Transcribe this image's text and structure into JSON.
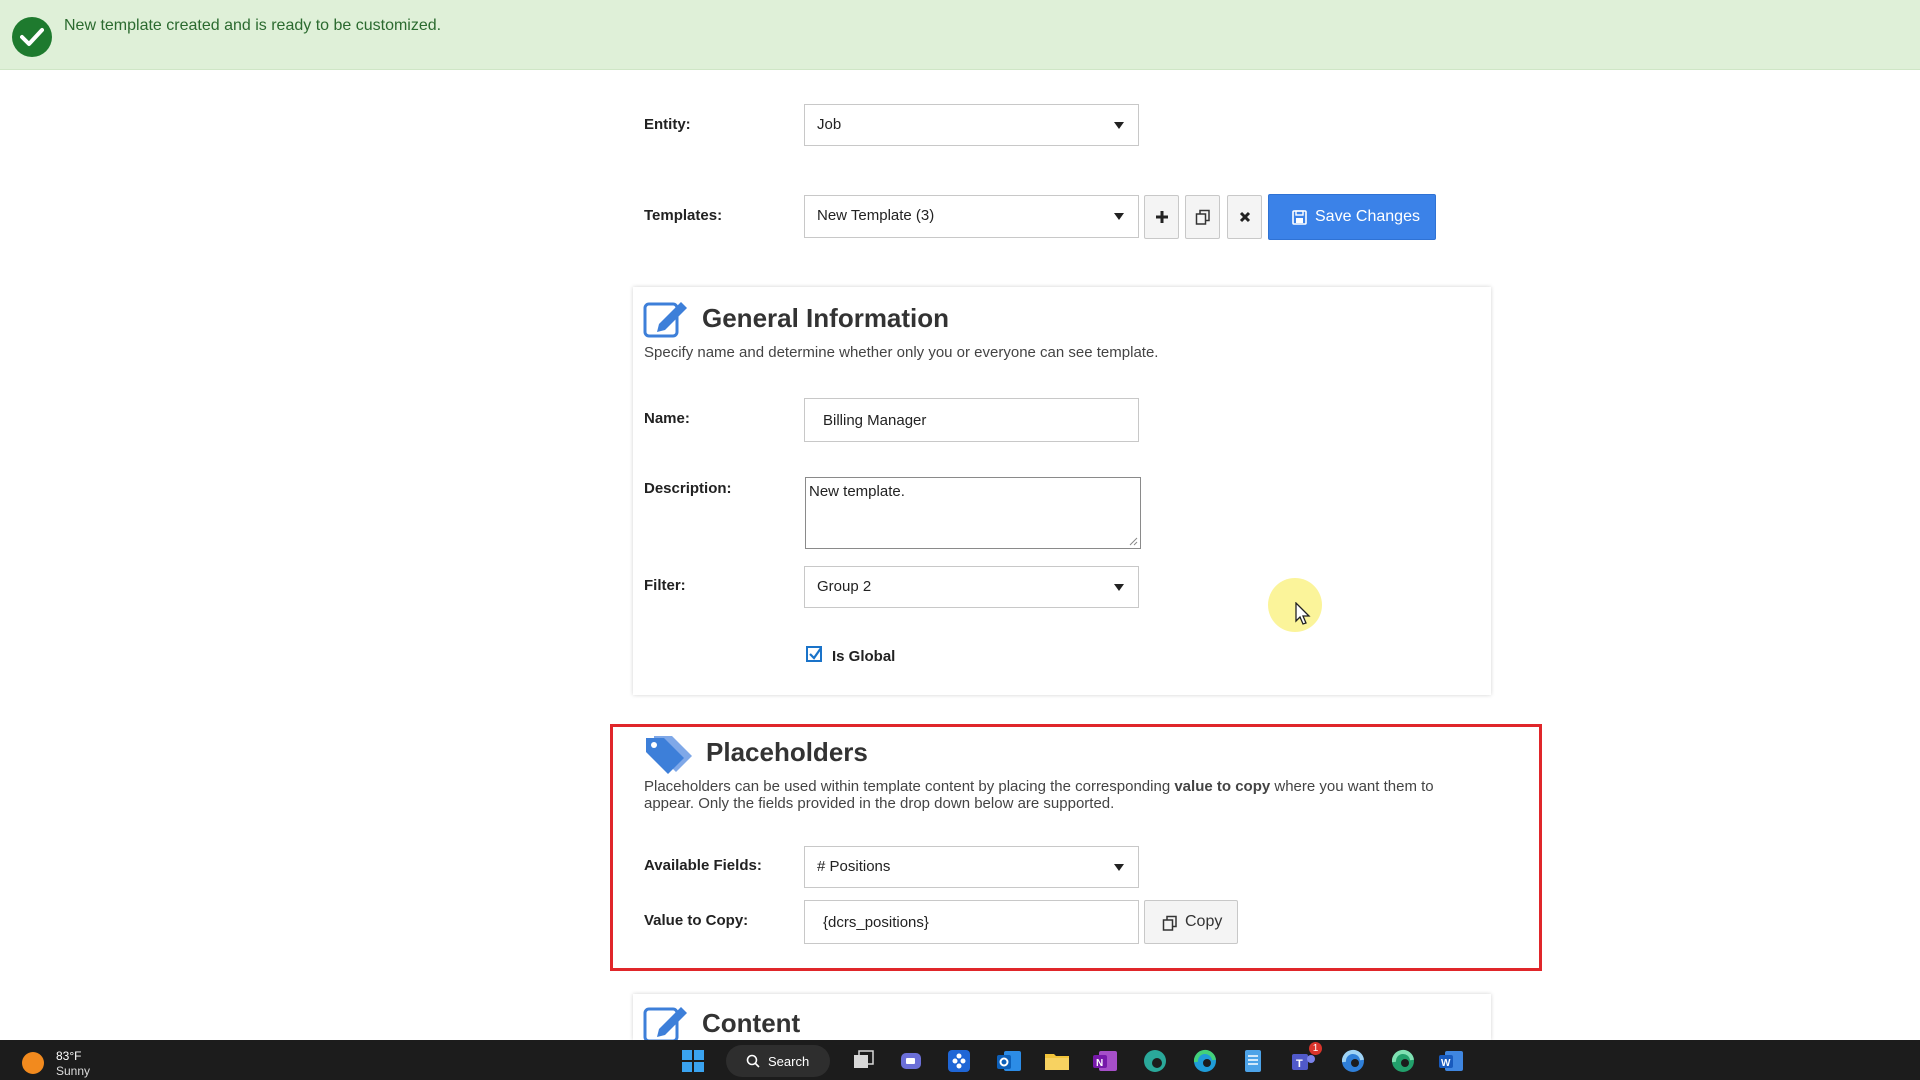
{
  "banner": {
    "message": "New template created and is ready to be customized."
  },
  "toolbar": {
    "entity_label": "Entity:",
    "entity_value": "Job",
    "templates_label": "Templates:",
    "templates_value": "New Template (3)",
    "save_label": "Save Changes"
  },
  "general": {
    "title": "General Information",
    "subtitle": "Specify name and determine whether only you or everyone can see template.",
    "name_label": "Name:",
    "name_value": "Billing Manager",
    "description_label": "Description:",
    "description_value": "New template.",
    "filter_label": "Filter:",
    "filter_value": "Group 2",
    "is_global_label": "Is Global",
    "is_global_checked": true
  },
  "placeholders": {
    "title": "Placeholders",
    "desc_part1": "Placeholders can be used within template content by placing the corresponding ",
    "desc_bold": "value to copy",
    "desc_part2": " where you want them to",
    "desc_line2": "appear. Only the fields provided in the drop down below are supported.",
    "fields_label": "Available Fields:",
    "fields_value": "# Positions",
    "copy_label": "Value to Copy:",
    "copy_value": "{dcrs_positions}",
    "copy_button": "Copy"
  },
  "content": {
    "title": "Content"
  },
  "taskbar": {
    "temperature": "83°F",
    "condition": "Sunny",
    "search_label": "Search",
    "teams_badge": "1"
  },
  "colors": {
    "accent": "#3b82e8",
    "success_bg": "#dff0d8",
    "highlight": "#e0262a"
  }
}
